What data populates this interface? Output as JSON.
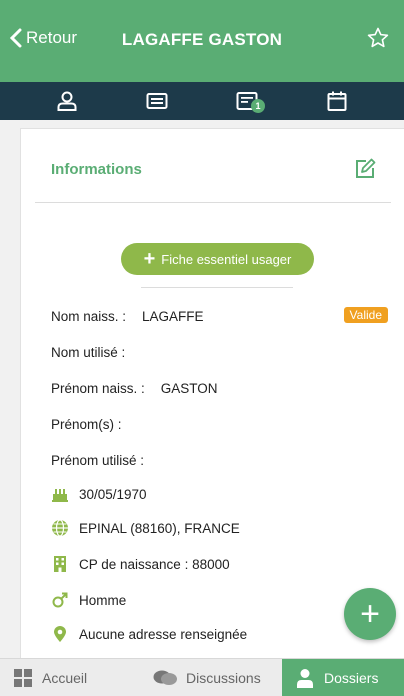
{
  "header": {
    "back_label": "Retour",
    "title": "LAGAFFE GASTON",
    "badge_count": "1",
    "accent_color": "#5aad74",
    "nav_color": "#1d3a4a"
  },
  "card": {
    "title": "Informations",
    "fiche_button_label": "Fiche essentiel usager",
    "status_badge": "Valide",
    "fields": [
      {
        "label": "Nom naiss. :",
        "value": "LAGAFFE"
      },
      {
        "label": "Nom utilisé :",
        "value": ""
      },
      {
        "label": "Prénom naiss. :",
        "value": "GASTON"
      },
      {
        "label": "Prénom(s) :",
        "value": ""
      },
      {
        "label": "Prénom utilisé :",
        "value": ""
      }
    ],
    "details": [
      {
        "icon": "birthday-cake-icon",
        "text": "30/05/1970"
      },
      {
        "icon": "globe-icon",
        "text": "EPINAL (88160), FRANCE"
      },
      {
        "icon": "building-icon",
        "text": "CP de naissance : 88000"
      },
      {
        "icon": "male-icon",
        "text": "Homme"
      },
      {
        "icon": "location-pin-icon",
        "text": "Aucune adresse renseignée"
      }
    ]
  },
  "fab_label": "+",
  "tabbar": {
    "accueil": "Accueil",
    "discussions": "Discussions",
    "dossiers": "Dossiers"
  }
}
